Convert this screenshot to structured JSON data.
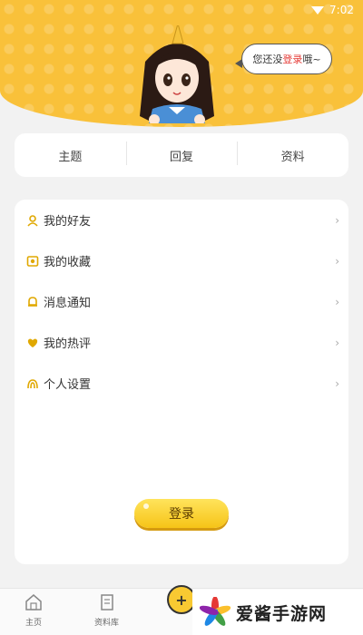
{
  "status": {
    "time": "7:02"
  },
  "header": {
    "bubble_pre": "您还没",
    "bubble_link": "登录",
    "bubble_post": "哦~"
  },
  "tabs": [
    {
      "label": "主题"
    },
    {
      "label": "回复"
    },
    {
      "label": "资料"
    }
  ],
  "menu": [
    {
      "label": "我的好友",
      "icon": "friends-icon"
    },
    {
      "label": "我的收藏",
      "icon": "favorites-icon"
    },
    {
      "label": "消息通知",
      "icon": "bell-icon"
    },
    {
      "label": "我的热评",
      "icon": "hot-comment-icon"
    },
    {
      "label": "个人设置",
      "icon": "settings-icon"
    }
  ],
  "login_button": "登录",
  "bottom_nav": [
    {
      "label": "主页",
      "icon": "home-icon"
    },
    {
      "label": "资料库",
      "icon": "library-icon"
    }
  ],
  "watermark": {
    "text": "爱酱手游网"
  },
  "colors": {
    "accent": "#f9c13a",
    "link": "#e53935",
    "button": "#f6c417"
  }
}
